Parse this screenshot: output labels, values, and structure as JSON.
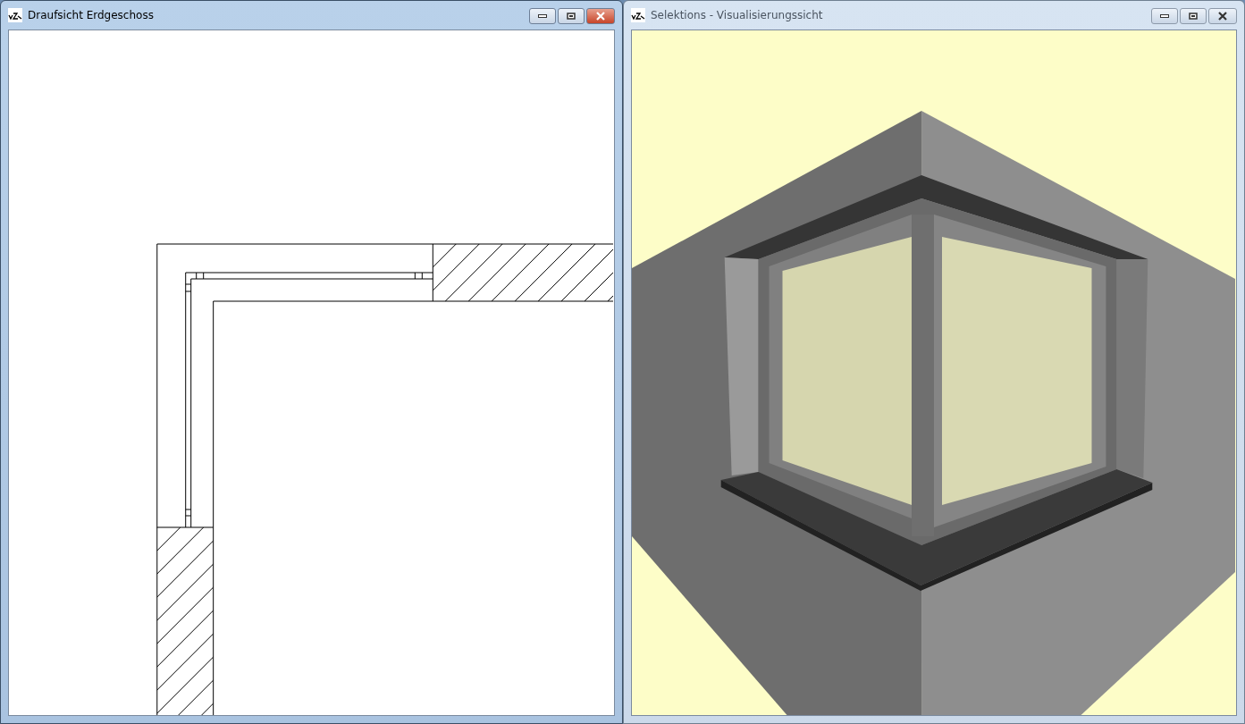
{
  "windows": [
    {
      "title": "Draufsicht Erdgeschoss",
      "active": true,
      "kind": "plan"
    },
    {
      "title": "Selektions - Visualisierungssicht",
      "active": false,
      "kind": "render"
    }
  ]
}
